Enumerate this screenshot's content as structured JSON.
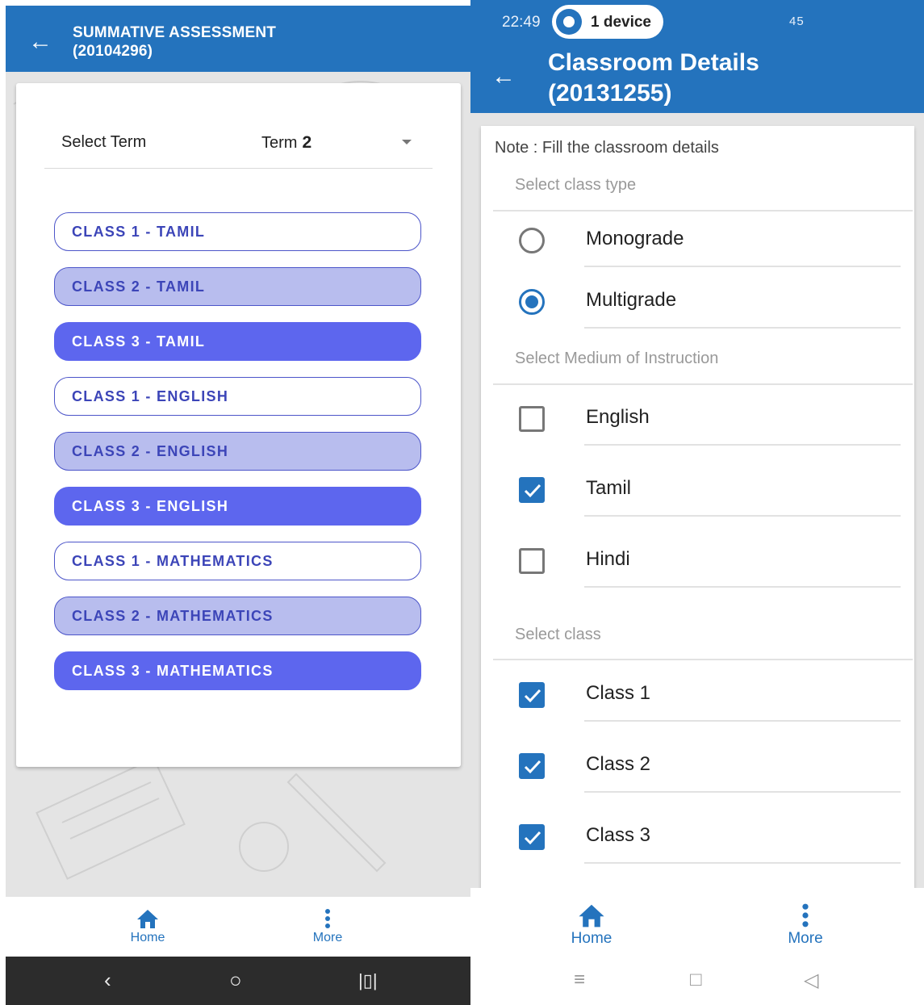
{
  "left_screen": {
    "title_line1": "SUMMATIVE ASSESSMENT",
    "title_line2": "(20104296)",
    "term_label": "Select Term",
    "term_prefix": "Term",
    "term_number": "2",
    "class_buttons": [
      {
        "label": "CLASS 1 - TAMIL",
        "style": "outlined"
      },
      {
        "label": "CLASS 2 - TAMIL",
        "style": "light"
      },
      {
        "label": "CLASS 3 - TAMIL",
        "style": "filled"
      },
      {
        "label": "CLASS 1 - ENGLISH",
        "style": "outlined"
      },
      {
        "label": "CLASS 2 - ENGLISH",
        "style": "light"
      },
      {
        "label": "CLASS 3 - ENGLISH",
        "style": "filled"
      },
      {
        "label": "CLASS 1 - MATHEMATICS",
        "style": "outlined"
      },
      {
        "label": "CLASS 2 - MATHEMATICS",
        "style": "light"
      },
      {
        "label": "CLASS 3 - MATHEMATICS",
        "style": "filled"
      }
    ],
    "nav": {
      "home": "Home",
      "more": "More"
    }
  },
  "right_screen": {
    "status_time": "22:49",
    "status_pill": "1 device",
    "status_right": "45",
    "title_line1": "Classroom Details",
    "title_line2": "(20131255)",
    "note": "Note : Fill the classroom details",
    "class_type_label": "Select class type",
    "class_types": [
      {
        "label": "Monograde",
        "selected": false
      },
      {
        "label": "Multigrade",
        "selected": true
      }
    ],
    "medium_label": "Select Medium of Instruction",
    "mediums": [
      {
        "label": "English",
        "checked": false
      },
      {
        "label": "Tamil",
        "checked": true
      },
      {
        "label": "Hindi",
        "checked": false
      }
    ],
    "class_label": "Select class",
    "classes": [
      {
        "label": "Class 1",
        "checked": true
      },
      {
        "label": "Class 2",
        "checked": true
      },
      {
        "label": "Class 3",
        "checked": true
      }
    ],
    "nav": {
      "home": "Home",
      "more": "More"
    }
  },
  "colors": {
    "primary": "#2473bd",
    "accent_filled": "#5d66ee",
    "accent_light": "#b8bdee",
    "accent_text": "#3c45b8"
  },
  "icons": [
    "back-arrow-icon",
    "dropdown-caret-icon",
    "home-icon",
    "more-vert-icon",
    "hotspot-icon",
    "checkmark-icon"
  ]
}
